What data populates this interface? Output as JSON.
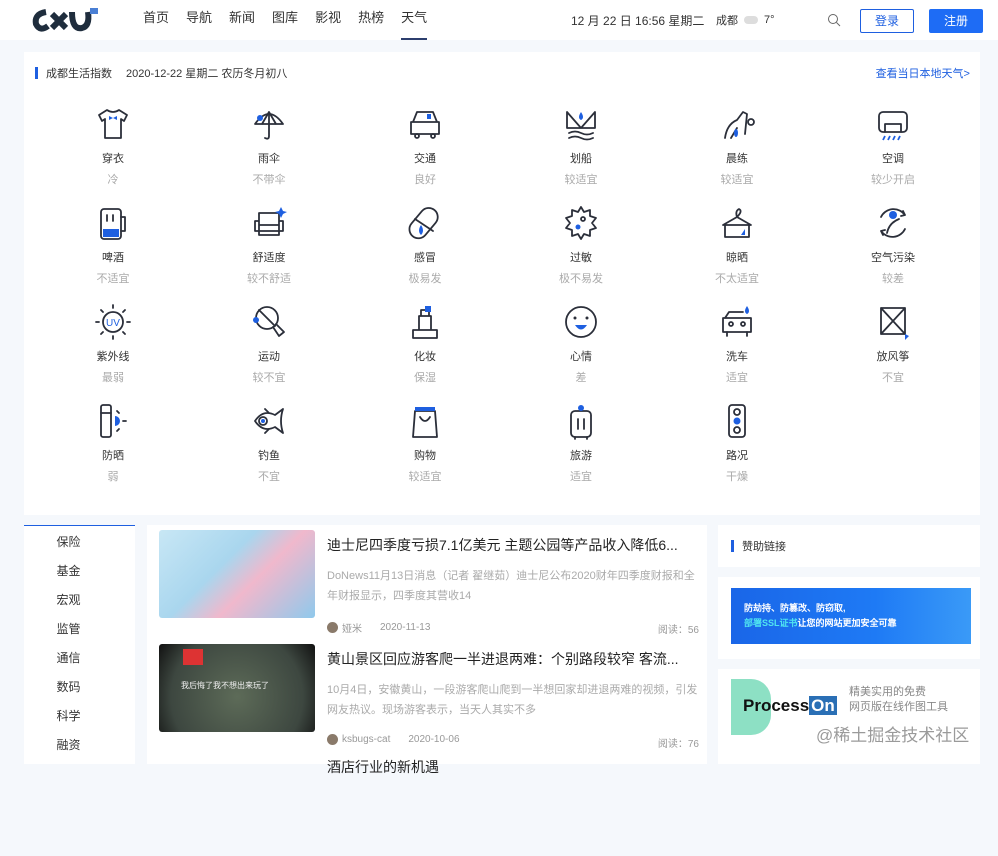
{
  "header": {
    "logo": "CXJ",
    "nav": [
      "首页",
      "导航",
      "新闻",
      "图库",
      "影视",
      "热榜",
      "天气"
    ],
    "active_nav": 6,
    "datetime": "12 月 22 日 16:56 星期二",
    "city": "成都",
    "temp": "7°",
    "login": "登录",
    "register": "注册"
  },
  "life": {
    "title": "成都生活指数",
    "date": "2020-12-22 星期二 农历冬月初八",
    "more": "查看当日本地天气>",
    "items": [
      {
        "icon": "shirt",
        "name": "穿衣",
        "value": "冷"
      },
      {
        "icon": "umbrella",
        "name": "雨伞",
        "value": "不带伞"
      },
      {
        "icon": "car",
        "name": "交通",
        "value": "良好"
      },
      {
        "icon": "boat",
        "name": "划船",
        "value": "较适宜"
      },
      {
        "icon": "exercise",
        "name": "晨练",
        "value": "较适宜"
      },
      {
        "icon": "aircon",
        "name": "空调",
        "value": "较少开启"
      },
      {
        "icon": "beer",
        "name": "啤酒",
        "value": "不适宜"
      },
      {
        "icon": "sofa",
        "name": "舒适度",
        "value": "较不舒适"
      },
      {
        "icon": "pill",
        "name": "感冒",
        "value": "极易发"
      },
      {
        "icon": "allergy",
        "name": "过敏",
        "value": "极不易发"
      },
      {
        "icon": "hanger",
        "name": "晾晒",
        "value": "不太适宜"
      },
      {
        "icon": "air",
        "name": "空气污染",
        "value": "较差"
      },
      {
        "icon": "uv",
        "name": "紫外线",
        "value": "最弱"
      },
      {
        "icon": "sport",
        "name": "运动",
        "value": "较不宜"
      },
      {
        "icon": "makeup",
        "name": "化妆",
        "value": "保湿"
      },
      {
        "icon": "mood",
        "name": "心情",
        "value": "差"
      },
      {
        "icon": "carwash",
        "name": "洗车",
        "value": "适宜"
      },
      {
        "icon": "kite",
        "name": "放风筝",
        "value": "不宜"
      },
      {
        "icon": "sunscreen",
        "name": "防晒",
        "value": "弱"
      },
      {
        "icon": "fish",
        "name": "钓鱼",
        "value": "不宜"
      },
      {
        "icon": "bag",
        "name": "购物",
        "value": "较适宜"
      },
      {
        "icon": "luggage",
        "name": "旅游",
        "value": "适宜"
      },
      {
        "icon": "traffic",
        "name": "路况",
        "value": "干燥"
      }
    ]
  },
  "sidebar": [
    "保险",
    "基金",
    "宏观",
    "监管",
    "通信",
    "数码",
    "科学",
    "融资"
  ],
  "articles": [
    {
      "title": "迪士尼四季度亏损7.1亿美元 主题公园等产品收入降低6...",
      "desc": "DoNews11月13日消息（记者 翟继茹）迪士尼公布2020财年四季度财报和全年财报显示，四季度其营收14",
      "author": "娅米",
      "date": "2020-11-13",
      "reads": "阅读：56"
    },
    {
      "title": "黄山景区回应游客爬一半进退两难：个别路段较窄 客流...",
      "desc": "10月4日，安徽黄山，一段游客爬山爬到一半想回家却进退两难的视频，引发网友热议。现场游客表示，当天人其实不多",
      "author": "ksbugs-cat",
      "date": "2020-10-06",
      "reads": "阅读：76",
      "thumb_text": "我后悔了我不想出来玩了"
    },
    {
      "title": "酒店行业的新机遇"
    }
  ],
  "sponsor": {
    "title": "赞助链接",
    "ad1_line1": "防劫持、防篡改、防窃取,",
    "ad1_hl": "部署SSL证书",
    "ad1_line2": "让您的网站更加安全可靠",
    "ad2_brand": "Process",
    "ad2_on": "On",
    "ad2_s1": "精美实用的免费",
    "ad2_s2": "网页版在线作图工具"
  },
  "watermark": "@稀土掘金技术社区",
  "colors": {
    "accent": "#1e5fe0"
  }
}
